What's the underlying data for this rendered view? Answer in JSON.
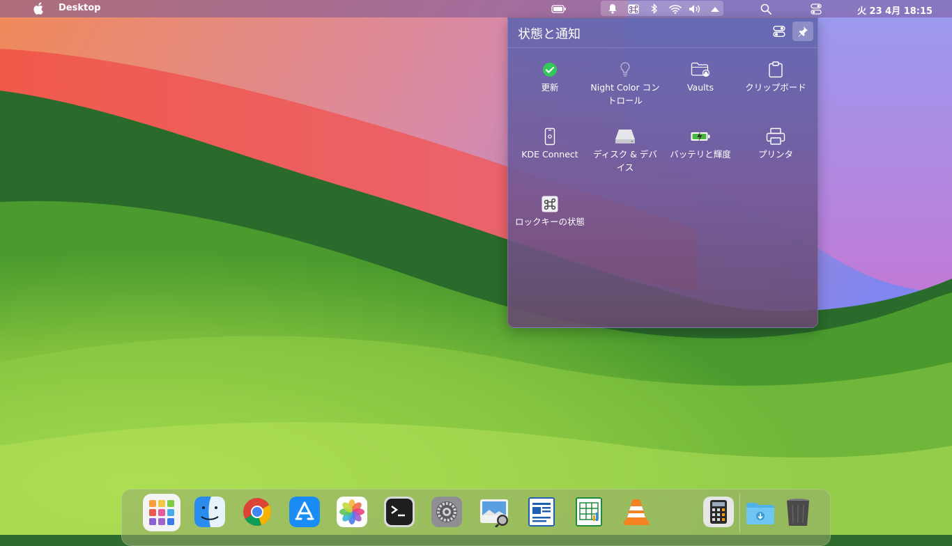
{
  "menubar": {
    "app_name": "Desktop",
    "clock": "火 23 4月 18:15",
    "icons": [
      "apple-icon",
      "battery-icon",
      "notifications-icon",
      "lock-keys-icon",
      "bluetooth-icon",
      "wifi-icon",
      "volume-icon",
      "expand-tray-icon",
      "search-icon",
      "control-center-icon"
    ]
  },
  "popup": {
    "title": "状態と通知",
    "items": [
      {
        "label": "更新",
        "icon": "check-circle-icon"
      },
      {
        "label": "Night Color コントロール",
        "icon": "lightbulb-icon"
      },
      {
        "label": "Vaults",
        "icon": "vault-folder-icon"
      },
      {
        "label": "クリップボード",
        "icon": "clipboard-icon"
      },
      {
        "label": "KDE Connect",
        "icon": "phone-icon"
      },
      {
        "label": "ディスク & デバイス",
        "icon": "disk-icon"
      },
      {
        "label": "バッテリと輝度",
        "icon": "battery-brightness-icon"
      },
      {
        "label": "プリンタ",
        "icon": "printer-icon"
      },
      {
        "label": "ロックキーの状態",
        "icon": "lock-keys-status-icon"
      }
    ]
  },
  "dock": {
    "apps": [
      "launchpad",
      "finder",
      "chrome",
      "app-store",
      "photos",
      "terminal",
      "system-settings",
      "preview",
      "writer",
      "calc",
      "vlc",
      "calculator",
      "downloads",
      "trash"
    ]
  },
  "colors": {
    "accent_green": "#34c759",
    "menubar": "#785896",
    "popup": "#6266b0"
  }
}
